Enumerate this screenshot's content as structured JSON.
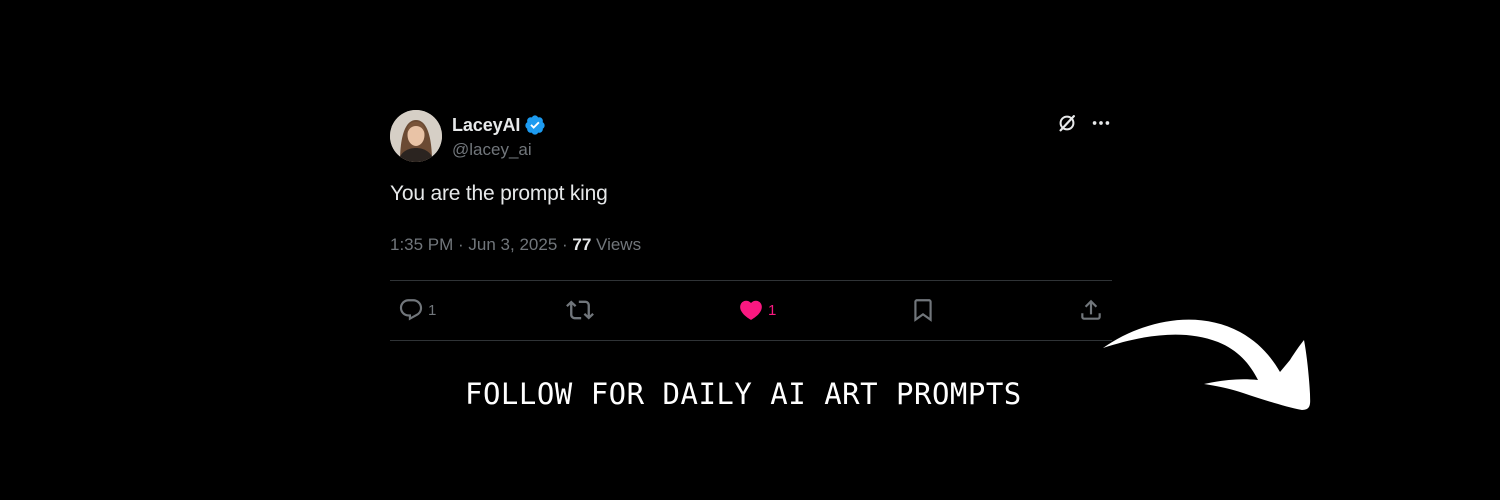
{
  "tweet": {
    "display_name": "LaceyAI",
    "handle": "@lacey_ai",
    "text": "You are the prompt king",
    "time": "1:35 PM",
    "separator": " · ",
    "date": "Jun 3, 2025",
    "views_count": "77",
    "views_label": "Views"
  },
  "actions": {
    "replies": "1",
    "reposts": "",
    "likes": "1"
  },
  "cta": {
    "text": "FOLLOW FOR DAILY AI ART PROMPTS"
  },
  "icons": {
    "verified": "verified-badge-icon",
    "grok": "grok-icon",
    "more": "more-icon",
    "reply": "reply-icon",
    "repost": "repost-icon",
    "like": "heart-icon",
    "bookmark": "bookmark-icon",
    "share": "share-icon",
    "arrow": "curved-arrow-icon"
  },
  "colors": {
    "background": "#000000",
    "text": "#e7e9ea",
    "muted": "#71767b",
    "divider": "#2f3336",
    "verified": "#1d9bf0",
    "like": "#f91880",
    "cta": "#ffffff"
  }
}
